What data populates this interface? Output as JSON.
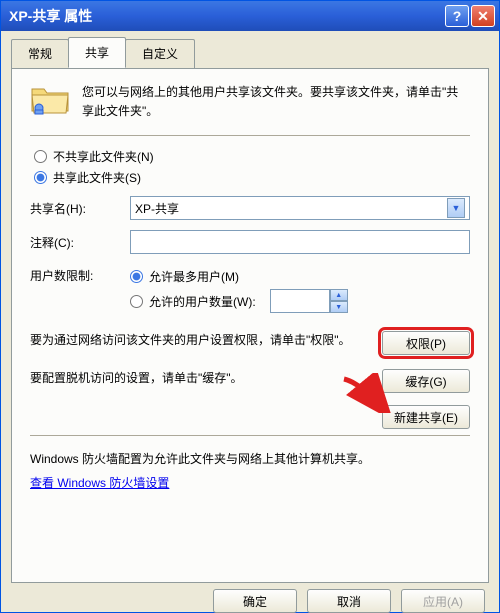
{
  "title": "XP-共享 属性",
  "tabs": {
    "general": "常规",
    "sharing": "共享",
    "custom": "自定义"
  },
  "intro": "您可以与网络上的其他用户共享该文件夹。要共享该文件夹，请单击\"共享此文件夹\"。",
  "shareMode": {
    "noShare": "不共享此文件夹(N)",
    "share": "共享此文件夹(S)"
  },
  "shareNameLabel": "共享名(H):",
  "shareNameValue": "XP-共享",
  "commentLabel": "注释(C):",
  "commentValue": "",
  "limitLabel": "用户数限制:",
  "limitOptions": {
    "max": "允许最多用户(M)",
    "count": "允许的用户数量(W):"
  },
  "limitCountValue": "",
  "permDesc": "要为通过网络访问该文件夹的用户设置权限，请单击\"权限\"。",
  "permBtn": "权限(P)",
  "cacheDesc": "要配置脱机访问的设置，请单击\"缓存\"。",
  "cacheBtn": "缓存(G)",
  "newShareBtn": "新建共享(E)",
  "firewallText": "Windows 防火墙配置为允许此文件夹与网络上其他计算机共享。",
  "firewallLink": "查看 Windows 防火墙设置",
  "dialogButtons": {
    "ok": "确定",
    "cancel": "取消",
    "apply": "应用(A)"
  }
}
